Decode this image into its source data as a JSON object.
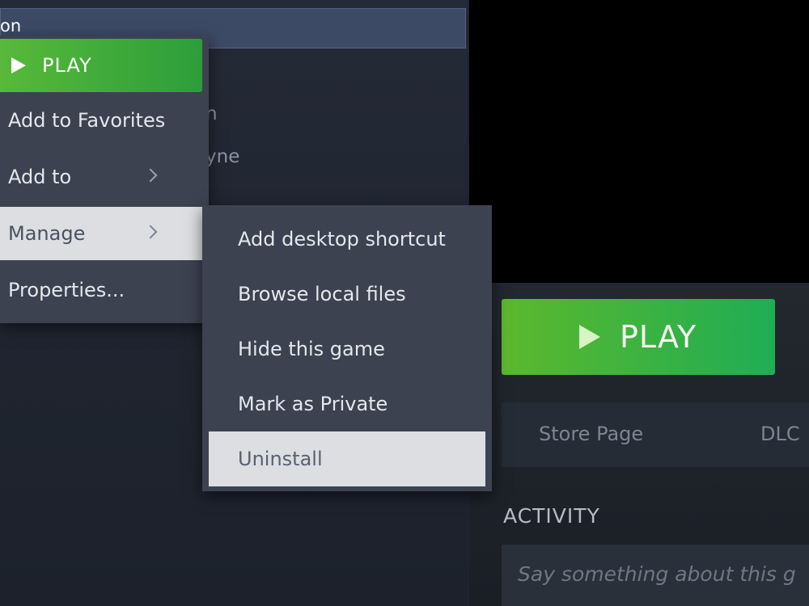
{
  "library": {
    "selected_game_fragment": "on",
    "fragment_1": "n",
    "fragment_2": "yne"
  },
  "context_menu": {
    "play_label": "PLAY",
    "items": [
      {
        "label": "Add to Favorites",
        "has_submenu": false
      },
      {
        "label": "Add to",
        "has_submenu": true
      },
      {
        "label": "Manage",
        "has_submenu": true,
        "highlighted": true
      },
      {
        "label": "Properties..."
      }
    ]
  },
  "manage_submenu": {
    "items": [
      {
        "label": "Add desktop shortcut"
      },
      {
        "label": "Browse local files"
      },
      {
        "label": "Hide this game"
      },
      {
        "label": "Mark as Private"
      },
      {
        "label": "Uninstall",
        "highlighted": true
      }
    ]
  },
  "game_detail": {
    "play_label": "PLAY",
    "tabs": [
      {
        "label": "Store Page"
      },
      {
        "label": "DLC"
      }
    ],
    "activity_heading": "ACTIVITY",
    "activity_placeholder": "Say something about this g"
  },
  "colors": {
    "play_green": "#5cb82c",
    "menu_bg": "#3c4250",
    "highlight_bg": "#dcdee2"
  }
}
